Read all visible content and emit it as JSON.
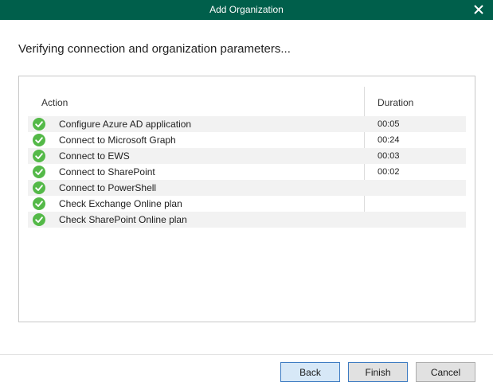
{
  "window": {
    "title": "Add Organization",
    "close_icon": "close-icon"
  },
  "heading": "Verifying connection and organization parameters...",
  "table": {
    "columns": {
      "action": "Action",
      "duration": "Duration"
    },
    "rows": [
      {
        "status": "success",
        "action": "Configure Azure AD application",
        "duration": "00:05"
      },
      {
        "status": "success",
        "action": "Connect to Microsoft Graph",
        "duration": "00:24"
      },
      {
        "status": "success",
        "action": "Connect to EWS",
        "duration": "00:03"
      },
      {
        "status": "success",
        "action": "Connect to SharePoint",
        "duration": "00:02"
      },
      {
        "status": "success",
        "action": "Connect to PowerShell",
        "duration": ""
      },
      {
        "status": "success",
        "action": "Check Exchange Online plan",
        "duration": ""
      },
      {
        "status": "success",
        "action": "Check SharePoint Online plan",
        "duration": ""
      }
    ]
  },
  "buttons": {
    "back": "Back",
    "finish": "Finish",
    "cancel": "Cancel"
  },
  "colors": {
    "titlebar": "#005f4b",
    "success": "#54b948"
  }
}
